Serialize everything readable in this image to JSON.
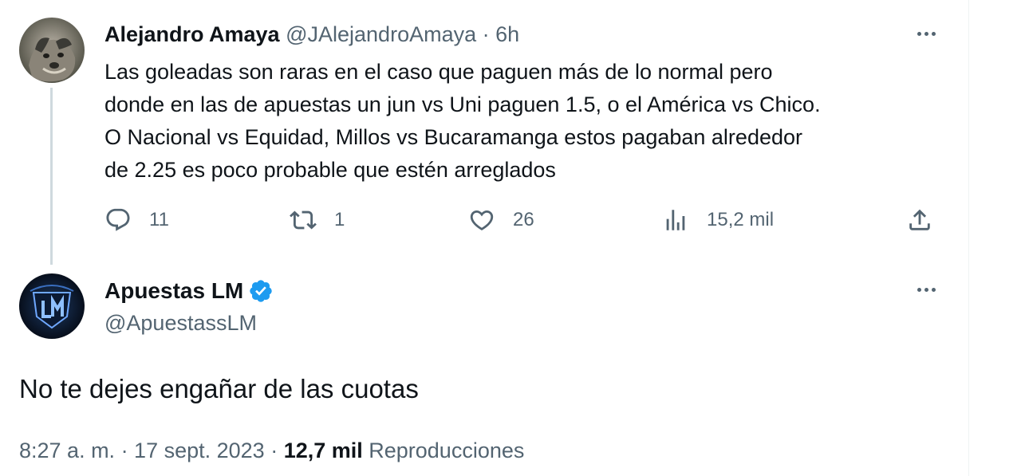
{
  "reply": {
    "display_name": "Alejandro Amaya",
    "meta": "@JAlejandroAmaya · 6h",
    "text": "Las goleadas son raras en el caso que paguen más de lo normal pero\ndonde en las de apuestas un jun vs Uni paguen 1.5, o el América vs Chico.\nO Nacional  vs Equidad, Millos vs Bucaramanga estos pagaban alrededor\nde 2.25 es poco probable que estén arreglados",
    "actions": {
      "replies": "11",
      "reposts": "1",
      "likes": "26",
      "views": "15,2 mil"
    }
  },
  "main": {
    "display_name": "Apuestas LM",
    "handle": "@ApuestassLM",
    "text": "No te dejes engañar de las cuotas",
    "time": "8:27 a. m. · 17 sept. 2023 · ",
    "views_count": "12,7 mil",
    "views_label": " Reproducciones"
  },
  "colors": {
    "secondary_text": "#536471",
    "verified": "#1d9bf0",
    "thread_line": "#cfd9de"
  }
}
